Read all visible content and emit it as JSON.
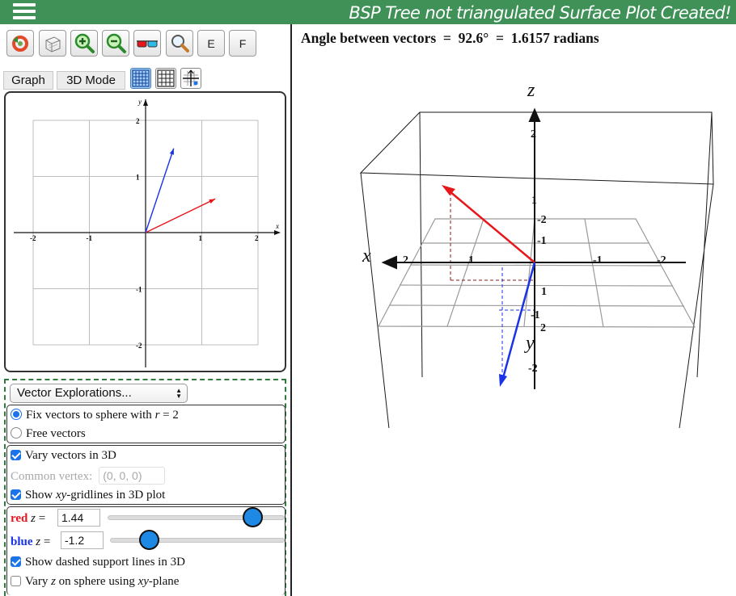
{
  "header": {
    "message": "BSP Tree not triangulated Surface Plot Created!",
    "menu_icon": "hamburger-menu-icon",
    "color": "#3f9158"
  },
  "toolbar": {
    "buttons": [
      {
        "icon": "reset-view-icon"
      },
      {
        "icon": "box-3d-icon"
      },
      {
        "icon": "zoom-in-icon"
      },
      {
        "icon": "zoom-out-icon"
      },
      {
        "icon": "3d-glasses-icon"
      },
      {
        "icon": "magnifier-icon"
      },
      {
        "label": "E"
      },
      {
        "label": "F"
      }
    ],
    "mode_buttons": {
      "graph": "Graph",
      "mode3d": "3D Mode"
    },
    "grid_buttons": [
      {
        "icon": "grid-labeled-icon",
        "active": true
      },
      {
        "icon": "grid-plain-icon",
        "active": false
      },
      {
        "icon": "grid-axes-icon",
        "active": false
      }
    ]
  },
  "graph2d": {
    "x_axis_label": "x",
    "y_axis_label": "y",
    "x_ticks": [
      "-2",
      "-1",
      "1",
      "2"
    ],
    "y_ticks": [
      "2",
      "1",
      "-1",
      "-2"
    ],
    "vectors": [
      {
        "name": "red",
        "color": "#e8161b",
        "x": 1.24,
        "y": 0.6
      },
      {
        "name": "blue",
        "color": "#1a33e8",
        "x": 0.5,
        "y": 1.5
      }
    ]
  },
  "controls": {
    "select_label": "Vector Explorations...",
    "radio_group": [
      {
        "label_prefix": "Fix vectors to sphere with ",
        "label_var": "r",
        "label_suffix": " = 2",
        "checked": true
      },
      {
        "label": "Free vectors",
        "checked": false
      }
    ],
    "vary3d": {
      "label": "Vary vectors in 3D",
      "checked": true
    },
    "common_vertex": {
      "label": "Common vertex:",
      "value": "(0, 0, 0)"
    },
    "show_grid": {
      "label_prefix": "Show ",
      "label_var": "xy",
      "label_suffix": "-gridlines in 3D plot",
      "checked": true
    },
    "red_z": {
      "name": "red",
      "var": "z",
      "eq": " =",
      "value": "1.44",
      "fraction": 0.9,
      "color": "#e8161b"
    },
    "blue_z": {
      "name": "blue",
      "var": "z",
      "eq": " =",
      "value": "-1.2",
      "fraction": 0.2,
      "color": "#1a33e8"
    },
    "dashed": {
      "label": "Show dashed support lines in 3D",
      "checked": true
    },
    "vary_z": {
      "label_prefix": "Vary ",
      "label_var": "z",
      "label_mid": " on sphere using ",
      "label_var2": "xy",
      "label_suffix": "-plane",
      "checked": false
    }
  },
  "angle": {
    "text": "Angle between vectors  =  92.6°  =  1.6157 radians",
    "degrees": 92.6,
    "radians": 1.6157
  },
  "plot3d": {
    "axis_labels": {
      "x": "x",
      "y": "y",
      "z": "z"
    },
    "z_ticks": [
      "2",
      "1"
    ],
    "x_ticks": [
      "2",
      "1",
      "-1",
      "-2"
    ],
    "y_ticks": [
      "-2",
      "-1",
      "1",
      "-1",
      "2",
      "-2"
    ],
    "red_color": "#e8161b",
    "blue_color": "#1a33e8"
  }
}
